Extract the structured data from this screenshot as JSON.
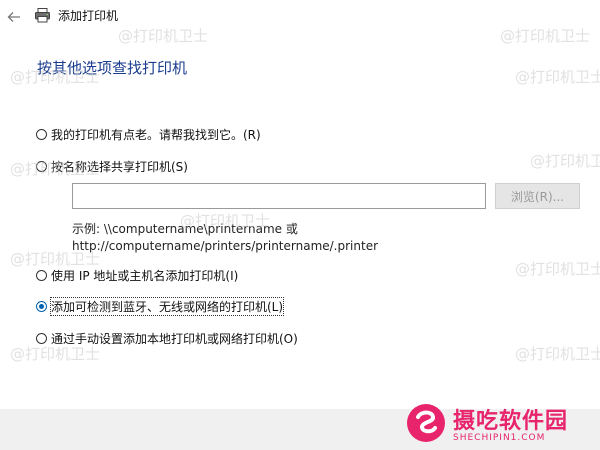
{
  "window": {
    "title": "添加打印机"
  },
  "heading": "按其他选项查找打印机",
  "options": [
    {
      "label": "我的打印机有点老。请帮我找到它。(R)",
      "checked": false
    },
    {
      "label": "按名称选择共享打印机(S)",
      "checked": false
    },
    {
      "label": "使用 IP 地址或主机名添加打印机(I)",
      "checked": false
    },
    {
      "label": "添加可检测到蓝牙、无线或网络的打印机(L)",
      "checked": true
    },
    {
      "label": "通过手动设置添加本地打印机或网络打印机(O)",
      "checked": false
    }
  ],
  "shared_printer": {
    "input_value": "",
    "browse_label": "浏览(R)...",
    "example_line1": "示例: \\\\computername\\printername 或",
    "example_line2": "http://computername/printers/printername/.printer"
  },
  "watermarks": [
    "@打印机卫士",
    "@打印机卫士",
    "@打印机卫士",
    "@打印机卫士",
    "@打印机卫士",
    "@打印机卫士",
    "@打印机卫士",
    "@打印机卫士",
    "@打印机卫士",
    "@打印机卫士",
    "@打印机卫士"
  ],
  "brand": {
    "name": "摄吃软件园",
    "url": "SHECHIPIN1.COM",
    "color": "#e8246c"
  },
  "colors": {
    "heading": "#1a3d8f",
    "radio_selected": "#0063b1"
  }
}
